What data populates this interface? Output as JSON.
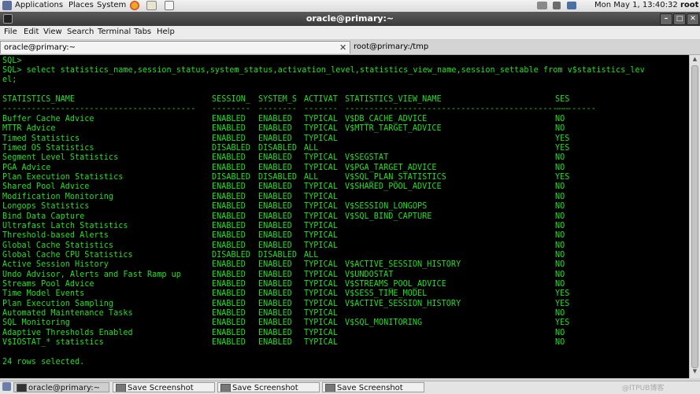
{
  "top_panel": {
    "applications": "Applications",
    "places": "Places",
    "system": "System",
    "datetime": "Mon May  1, 13:40:32",
    "user": "root"
  },
  "window": {
    "title": "oracle@primary:~"
  },
  "menu": [
    "File",
    "Edit",
    "View",
    "Search",
    "Terminal",
    "Tabs",
    "Help"
  ],
  "tabs": [
    {
      "label": "oracle@primary:~",
      "active": true
    },
    {
      "label": "root@primary:/tmp",
      "active": false
    }
  ],
  "terminal": {
    "prompt_empty": "SQL>",
    "command_line1": "SQL> select statistics_name,session_status,system_status,activation_level,statistics_view_name,session_settable from v$statistics_lev",
    "command_line2": "el;",
    "headers": [
      "STATISTICS_NAME",
      "SESSION_",
      "SYSTEM_S",
      "ACTIVAT",
      "STATISTICS_VIEW_NAME",
      "SES"
    ],
    "separators": [
      "----------------------------------------",
      "--------",
      "--------",
      "-------",
      "----------------------------------------------------",
      "---"
    ],
    "rows": [
      [
        "Buffer Cache Advice",
        "ENABLED",
        "ENABLED",
        "TYPICAL",
        "V$DB_CACHE_ADVICE",
        "NO"
      ],
      [
        "MTTR Advice",
        "ENABLED",
        "ENABLED",
        "TYPICAL",
        "V$MTTR_TARGET_ADVICE",
        "NO"
      ],
      [
        "Timed Statistics",
        "ENABLED",
        "ENABLED",
        "TYPICAL",
        "",
        "YES"
      ],
      [
        "Timed OS Statistics",
        "DISABLED",
        "DISABLED",
        "ALL",
        "",
        "YES"
      ],
      [
        "Segment Level Statistics",
        "ENABLED",
        "ENABLED",
        "TYPICAL",
        "V$SEGSTAT",
        "NO"
      ],
      [
        "PGA Advice",
        "ENABLED",
        "ENABLED",
        "TYPICAL",
        "V$PGA_TARGET_ADVICE",
        "NO"
      ],
      [
        "Plan Execution Statistics",
        "DISABLED",
        "DISABLED",
        "ALL",
        "V$SQL_PLAN_STATISTICS",
        "YES"
      ],
      [
        "Shared Pool Advice",
        "ENABLED",
        "ENABLED",
        "TYPICAL",
        "V$SHARED_POOL_ADVICE",
        "NO"
      ],
      [
        "Modification Monitoring",
        "ENABLED",
        "ENABLED",
        "TYPICAL",
        "",
        "NO"
      ],
      [
        "Longops Statistics",
        "ENABLED",
        "ENABLED",
        "TYPICAL",
        "V$SESSION_LONGOPS",
        "NO"
      ],
      [
        "Bind Data Capture",
        "ENABLED",
        "ENABLED",
        "TYPICAL",
        "V$SQL_BIND_CAPTURE",
        "NO"
      ],
      [
        "Ultrafast Latch Statistics",
        "ENABLED",
        "ENABLED",
        "TYPICAL",
        "",
        "NO"
      ],
      [
        "Threshold-based Alerts",
        "ENABLED",
        "ENABLED",
        "TYPICAL",
        "",
        "NO"
      ],
      [
        "Global Cache Statistics",
        "ENABLED",
        "ENABLED",
        "TYPICAL",
        "",
        "NO"
      ],
      [
        "Global Cache CPU Statistics",
        "DISABLED",
        "DISABLED",
        "ALL",
        "",
        "NO"
      ],
      [
        "Active Session History",
        "ENABLED",
        "ENABLED",
        "TYPICAL",
        "V$ACTIVE_SESSION_HISTORY",
        "NO"
      ],
      [
        "Undo Advisor, Alerts and Fast Ramp up",
        "ENABLED",
        "ENABLED",
        "TYPICAL",
        "V$UNDOSTAT",
        "NO"
      ],
      [
        "Streams Pool Advice",
        "ENABLED",
        "ENABLED",
        "TYPICAL",
        "V$STREAMS_POOL_ADVICE",
        "NO"
      ],
      [
        "Time Model Events",
        "ENABLED",
        "ENABLED",
        "TYPICAL",
        "V$SESS_TIME_MODEL",
        "YES"
      ],
      [
        "Plan Execution Sampling",
        "ENABLED",
        "ENABLED",
        "TYPICAL",
        "V$ACTIVE_SESSION_HISTORY",
        "YES"
      ],
      [
        "Automated Maintenance Tasks",
        "ENABLED",
        "ENABLED",
        "TYPICAL",
        "",
        "NO"
      ],
      [
        "SQL Monitoring",
        "ENABLED",
        "ENABLED",
        "TYPICAL",
        "V$SQL_MONITORING",
        "YES"
      ],
      [
        "Adaptive Thresholds Enabled",
        "ENABLED",
        "ENABLED",
        "TYPICAL",
        "",
        "NO"
      ],
      [
        "V$IOSTAT_* statistics",
        "ENABLED",
        "ENABLED",
        "TYPICAL",
        "",
        "NO"
      ]
    ],
    "footer": "24 rows selected."
  },
  "taskbar": {
    "items": [
      "oracle@primary:~",
      "Save Screenshot",
      "Save Screenshot",
      "Save Screenshot"
    ]
  },
  "watermark": "@ITPUB博客",
  "colors": {
    "terminal_fg": "#1ee01e",
    "terminal_bg": "#000000"
  }
}
